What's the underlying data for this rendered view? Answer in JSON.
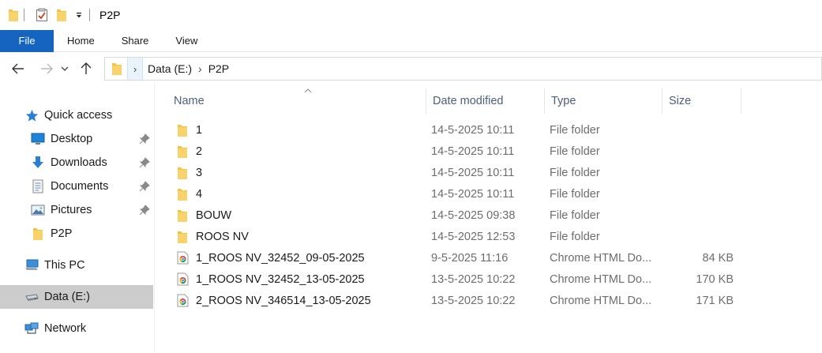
{
  "window": {
    "title": "P2P"
  },
  "ribbon": {
    "tabs": [
      "File",
      "Home",
      "Share",
      "View"
    ]
  },
  "address": {
    "crumbs": [
      "Data (E:)",
      "P2P"
    ]
  },
  "sidebar": {
    "quick_access": "Quick access",
    "pinned": [
      {
        "label": "Desktop",
        "icon": "desktop-icon"
      },
      {
        "label": "Downloads",
        "icon": "downloads-icon"
      },
      {
        "label": "Documents",
        "icon": "documents-icon"
      },
      {
        "label": "Pictures",
        "icon": "pictures-icon"
      },
      {
        "label": "P2P",
        "icon": "folder-icon"
      }
    ],
    "this_pc": "This PC",
    "drive": "Data (E:)",
    "network": "Network"
  },
  "columns": {
    "name": "Name",
    "date": "Date modified",
    "type": "Type",
    "size": "Size"
  },
  "files": [
    {
      "name": "1",
      "date": "14-5-2025 10:11",
      "type": "File folder",
      "size": "",
      "icon": "folder-icon"
    },
    {
      "name": "2",
      "date": "14-5-2025 10:11",
      "type": "File folder",
      "size": "",
      "icon": "folder-icon"
    },
    {
      "name": "3",
      "date": "14-5-2025 10:11",
      "type": "File folder",
      "size": "",
      "icon": "folder-icon"
    },
    {
      "name": "4",
      "date": "14-5-2025 10:11",
      "type": "File folder",
      "size": "",
      "icon": "folder-icon"
    },
    {
      "name": "BOUW",
      "date": "14-5-2025 09:38",
      "type": "File folder",
      "size": "",
      "icon": "folder-icon"
    },
    {
      "name": "ROOS NV",
      "date": "14-5-2025 12:53",
      "type": "File folder",
      "size": "",
      "icon": "folder-icon"
    },
    {
      "name": "1_ROOS NV_32452_09-05-2025",
      "date": "9-5-2025 11:16",
      "type": "Chrome HTML Do...",
      "size": "84 KB",
      "icon": "chrome-html-icon"
    },
    {
      "name": "1_ROOS NV_32452_13-05-2025",
      "date": "13-5-2025 10:22",
      "type": "Chrome HTML Do...",
      "size": "170 KB",
      "icon": "chrome-html-icon"
    },
    {
      "name": "2_ROOS NV_346514_13-05-2025",
      "date": "13-5-2025 10:22",
      "type": "Chrome HTML Do...",
      "size": "171 KB",
      "icon": "chrome-html-icon"
    }
  ],
  "colors": {
    "accent": "#1565c0",
    "folder": "#f5c343",
    "selected": "#cccccc"
  }
}
